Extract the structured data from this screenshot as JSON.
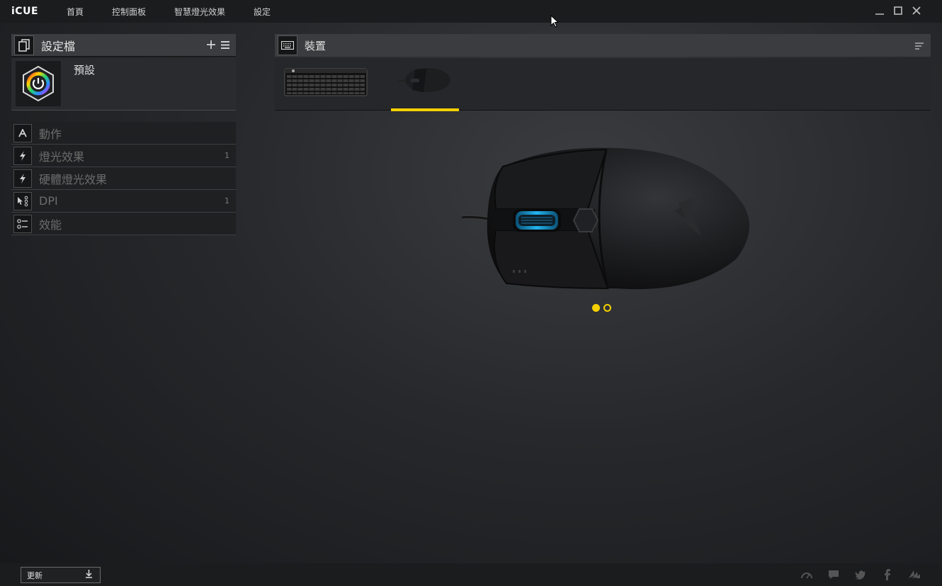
{
  "app": {
    "logo": "iCUE"
  },
  "nav": {
    "home": "首頁",
    "dashboard": "控制面板",
    "smart_lighting": "智慧燈光效果",
    "settings": "設定"
  },
  "profiles": {
    "title": "設定檔",
    "add_icon": "plus-icon",
    "menu_icon": "menu-icon",
    "items": [
      {
        "name": "預設"
      }
    ]
  },
  "sections": [
    {
      "label": "動作",
      "icon": "action-icon",
      "count": ""
    },
    {
      "label": "燈光效果",
      "icon": "lightning-icon",
      "count": "1"
    },
    {
      "label": "硬體燈光效果",
      "icon": "lightning-icon",
      "count": ""
    },
    {
      "label": "DPI",
      "icon": "dpi-icon",
      "count": "1"
    },
    {
      "label": "效能",
      "icon": "performance-icon",
      "count": ""
    }
  ],
  "devices": {
    "title": "裝置",
    "tabs": [
      {
        "name": "keyboard"
      },
      {
        "name": "mouse",
        "active": true
      }
    ],
    "pager": {
      "current": 1,
      "total": 2
    }
  },
  "footer": {
    "update_label": "更新"
  },
  "colors": {
    "accent": "#f5d000",
    "mouse_glow": "#1e9ad6"
  }
}
